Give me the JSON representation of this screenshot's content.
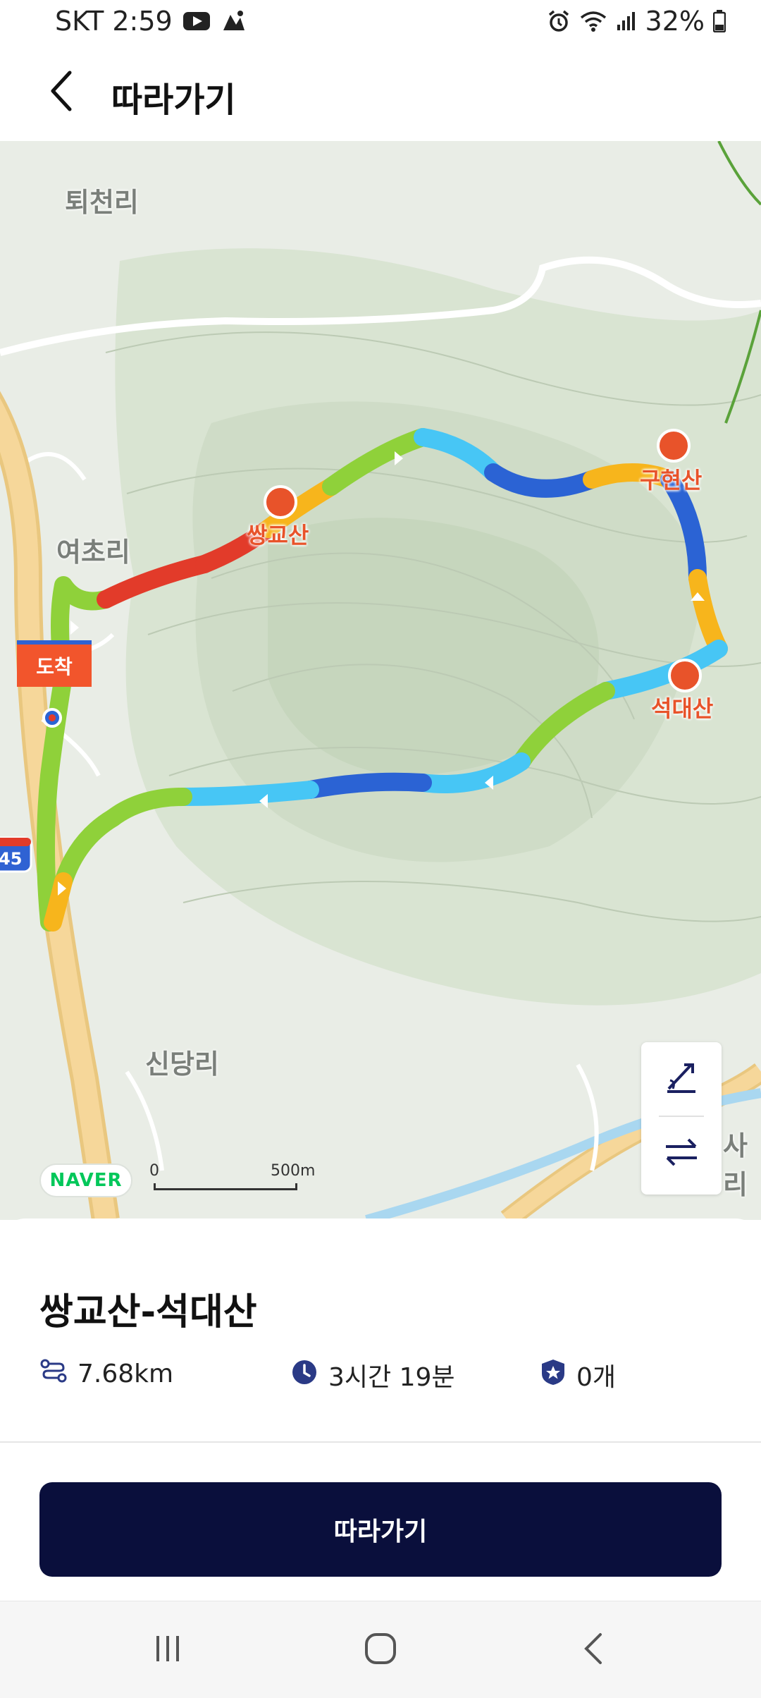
{
  "status_bar": {
    "carrier_time": "SKT 2:59",
    "battery": "32%",
    "icons": [
      "youtube-icon",
      "app-notification-icon",
      "alarm-icon",
      "wifi-icon",
      "signal-icon",
      "battery-icon"
    ]
  },
  "header": {
    "back_icon": "chevron-left-icon",
    "title": "따라가기"
  },
  "map": {
    "places": [
      "퇴천리",
      "여초리",
      "신당리",
      "사리"
    ],
    "peaks": [
      "쌍교산",
      "구현산",
      "석대산"
    ],
    "arrival_label": "도착",
    "highway_shield": "45",
    "provider_logo": "NAVER",
    "scale_zero": "0",
    "scale_label": "500m",
    "controls": [
      "elevation-toggle-icon",
      "swap-direction-icon"
    ],
    "route_colors": [
      "#8fd13a",
      "#f7b51c",
      "#e23b2a",
      "#47c6f5",
      "#2b63d4"
    ]
  },
  "route": {
    "name": "쌍교산-석대산",
    "distance": "7.68km",
    "duration": "3시간 19분",
    "badges": "0개"
  },
  "actions": {
    "follow_label": "따라가기"
  },
  "nav_bar": [
    "recent-apps-icon",
    "home-icon",
    "back-icon"
  ]
}
